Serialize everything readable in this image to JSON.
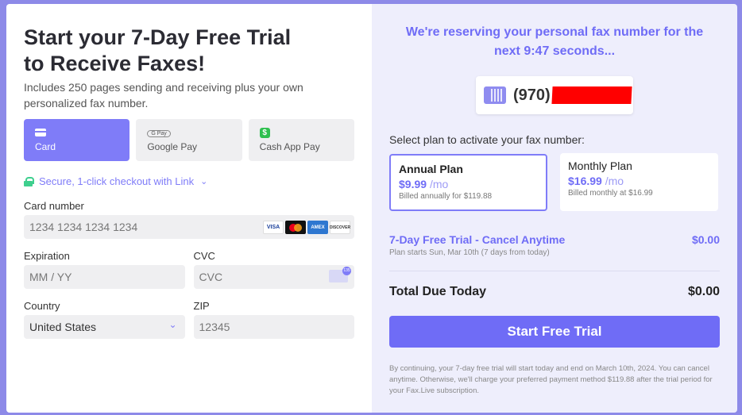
{
  "left": {
    "title_line1": "Start your 7-Day Free Trial",
    "title_line2": "to Receive Faxes!",
    "subtitle": "Includes 250 pages sending and receiving plus your own personalized fax number.",
    "methods": [
      {
        "label": "Card",
        "icon": "card-icon"
      },
      {
        "label": "Google Pay",
        "icon": "google-pay-icon",
        "badge": "G Pay"
      },
      {
        "label": "Cash App Pay",
        "icon": "cash-app-icon",
        "badge": "$"
      }
    ],
    "link_text": "Secure, 1-click checkout with Link",
    "card_number": {
      "label": "Card number",
      "placeholder": "1234 1234 1234 1234",
      "brands": [
        "VISA",
        "MC",
        "AMEX",
        "DISCOVER"
      ]
    },
    "expiration": {
      "label": "Expiration",
      "placeholder": "MM / YY"
    },
    "cvc": {
      "label": "CVC",
      "placeholder": "CVC",
      "badge": "135"
    },
    "country": {
      "label": "Country",
      "value": "United States"
    },
    "zip": {
      "label": "ZIP",
      "placeholder": "12345"
    }
  },
  "right": {
    "timer_text": "We're reserving your personal fax number for the next 9:47 seconds...",
    "fax_prefix": "(970)",
    "select_label": "Select plan to activate your fax number:",
    "plans": [
      {
        "name": "Annual Plan",
        "price": "$9.99",
        "per": "/mo",
        "billing": "Billed annually for $119.88",
        "selected": true
      },
      {
        "name": "Monthly Plan",
        "price": "$16.99",
        "per": "/mo",
        "billing": "Billed monthly at $16.99",
        "selected": false
      }
    ],
    "trial_title": "7-Day Free Trial - Cancel Anytime",
    "trial_detail": "Plan starts Sun, Mar 10th (7 days from today)",
    "trial_amount": "$0.00",
    "total_label": "Total Due Today",
    "total_amount": "$0.00",
    "cta": "Start Free Trial",
    "fine_print": "By continuing, your 7-day free trial will start today and end on March 10th, 2024. You can cancel anytime. Otherwise, we'll charge your preferred payment method $119.88 after the trial period for your Fax.Live subscription."
  },
  "colors": {
    "accent": "#6f6cf6",
    "selected_method": "#7f7cf8",
    "frame": "#8d8ae8",
    "right_bg": "#eeeefc",
    "redaction": "#ff0000"
  }
}
